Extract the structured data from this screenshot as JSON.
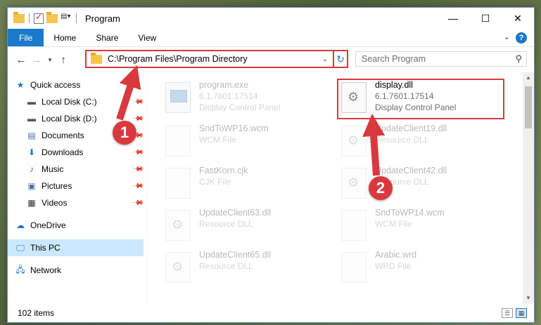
{
  "window": {
    "title": "Program"
  },
  "titlebar": {
    "minimize": "—",
    "maximize": "☐",
    "close": "✕"
  },
  "ribbon": {
    "tabs": [
      "File",
      "Home",
      "Share",
      "View"
    ],
    "help": "?"
  },
  "address": {
    "path": "C:\\Program Files\\Program Directory",
    "search_placeholder": "Search Program"
  },
  "nav": {
    "quick_access": "Quick access",
    "items": [
      "Local Disk (C:)",
      "Local Disk (D:)",
      "Documents",
      "Downloads",
      "Music",
      "Pictures",
      "Videos"
    ],
    "onedrive": "OneDrive",
    "this_pc": "This PC",
    "network": "Network"
  },
  "files": [
    {
      "name": "program.exe",
      "line2": "6.1.7601.17514",
      "line3": "Display Control Panel"
    },
    {
      "name": "display.dll",
      "line2": "6.1.7601.17514",
      "line3": "Display Control Panel"
    },
    {
      "name": "SndToWP16.wcm",
      "line2": "WCM File",
      "line3": ""
    },
    {
      "name": "UpdateClient19.dll",
      "line2": "Resource DLL",
      "line3": ""
    },
    {
      "name": "FastKorn.cjk",
      "line2": "CJK File",
      "line3": ""
    },
    {
      "name": "UpdateClient42.dll",
      "line2": "Resource DLL",
      "line3": ""
    },
    {
      "name": "UpdateClient63.dll",
      "line2": "Resource DLL",
      "line3": ""
    },
    {
      "name": "SndToWP14.wcm",
      "line2": "WCM File",
      "line3": ""
    },
    {
      "name": "UpdateClient65.dll",
      "line2": "Resource DLL",
      "line3": ""
    },
    {
      "name": "Arabic.wrd",
      "line2": "WRD File",
      "line3": ""
    }
  ],
  "status": {
    "items": "102 items"
  },
  "annotations": {
    "step1": "1",
    "step2": "2",
    "color": "#d9393e"
  }
}
